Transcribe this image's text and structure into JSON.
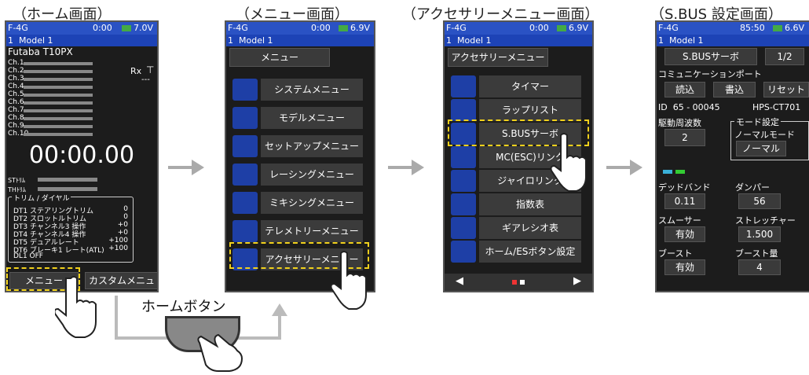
{
  "captions": [
    "（ホーム画面）",
    "（メニュー画面）",
    "（アクセサリーメニュー画面）",
    "（S.BUS 設定画面）"
  ],
  "home": {
    "status": {
      "left": "F-4G",
      "time": "0:00",
      "voltage": "7.0V"
    },
    "model": {
      "num": "1",
      "name": "Model 1"
    },
    "radio": "Futaba T10PX",
    "channels": [
      "Ch.1",
      "Ch.2",
      "Ch.3",
      "Ch.4",
      "Ch.5",
      "Ch.6",
      "Ch.7",
      "Ch.8",
      "Ch.9",
      "Ch.10"
    ],
    "rx": "Rx",
    "rx_value": "---",
    "timer": "00:00.00",
    "st_trim": "STﾄﾘﾑ",
    "th_trim": "THﾄﾘﾑ",
    "trim_title": "トリム / ダイヤル",
    "trim_rows": [
      {
        "code": "DT1",
        "name": "ステアリングトリム",
        "val": "0"
      },
      {
        "code": "DT2",
        "name": "スロットルトリム",
        "val": "0"
      },
      {
        "code": "DT3",
        "name": "チャンネル3 操作",
        "val": "+0"
      },
      {
        "code": "DT4",
        "name": "チャンネル4 操作",
        "val": "+0"
      },
      {
        "code": "DT5",
        "name": "デュアルレート",
        "val": "+100"
      },
      {
        "code": "DT6",
        "name": "ブレーキ1 レート(ATL)",
        "val": "+100"
      },
      {
        "code": "DL1",
        "name": "OFF",
        "val": ""
      }
    ],
    "menu_btn": "メニュー",
    "custom_btn": "カスタムメニュー"
  },
  "home_button_label": "ホームボタン",
  "menu": {
    "status": {
      "left": "F-4G",
      "time": "0:00",
      "voltage": "6.9V"
    },
    "model": {
      "num": "1",
      "name": "Model 1"
    },
    "title": "メニュー",
    "items": [
      {
        "icon": "SYS",
        "label": "システムメニュー"
      },
      {
        "icon": "MDL",
        "label": "モデルメニュー"
      },
      {
        "icon": "",
        "label": "セットアップメニュー"
      },
      {
        "icon": "",
        "label": "レーシングメニュー"
      },
      {
        "icon": "",
        "label": "ミキシングメニュー"
      },
      {
        "icon": "TELE",
        "label": "テレメトリーメニュー"
      },
      {
        "icon": "ACC",
        "label": "アクセサリーメニュー"
      }
    ]
  },
  "acc": {
    "status": {
      "left": "F-4G",
      "time": "0:00",
      "voltage": "6.9V"
    },
    "model": {
      "num": "1",
      "name": "Model 1"
    },
    "title": "アクセサリーメニュー",
    "items": [
      {
        "label": "タイマー"
      },
      {
        "label": "ラップリスト"
      },
      {
        "label": "S.BUSサーボ"
      },
      {
        "label": "MC(ESC)リンク"
      },
      {
        "label": "ジャイロリンク"
      },
      {
        "label": "指数表"
      },
      {
        "label": "ギアレシオ表"
      },
      {
        "label": "ホーム/ESボタン設定"
      }
    ],
    "prev": "◀",
    "next": "▶"
  },
  "sbus": {
    "status": {
      "left": "F-4G",
      "time": "85:50",
      "voltage": "6.6V"
    },
    "model": {
      "num": "1",
      "name": "Model 1"
    },
    "title": "S.BUSサーボ",
    "page": "1/2",
    "comm": "コミュニケーションポート",
    "read": "読込",
    "write": "書込",
    "reset": "リセット",
    "id_label": "ID",
    "id_value": "65 - 00045",
    "servo_model": "HPS-CT701",
    "freq_label": "駆動周波数",
    "freq_value": "2",
    "mode_group": "モード設定",
    "mode_label": "ノーマルモード",
    "mode_value": "ノーマル",
    "deadband_label": "デッドバンド",
    "deadband_value": "0.11",
    "damper_label": "ダンパー",
    "damper_value": "56",
    "smoother_label": "スムーサー",
    "smoother_value": "有効",
    "stretcher_label": "ストレッチャー",
    "stretcher_value": "1.500",
    "boost_label": "ブースト",
    "boost_value": "有効",
    "boost_amount_label": "ブースト量",
    "boost_amount_value": "4"
  },
  "colors": {
    "status_blue": "#2a52c4",
    "highlight": "#f1d11c",
    "menu_icon": "#1e3fa6"
  }
}
